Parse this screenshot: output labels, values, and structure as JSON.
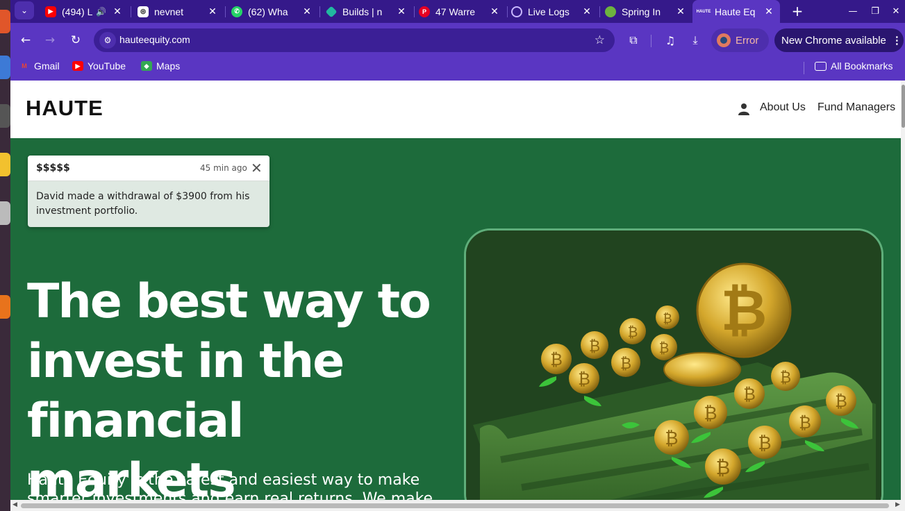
{
  "tabs": [
    {
      "title": "(494) L",
      "favicon": "youtube-icon",
      "color": "#ff0000",
      "audio": true
    },
    {
      "title": "nevnet",
      "favicon": "chatgpt-icon",
      "color": "#ffffff"
    },
    {
      "title": "(62) Wha",
      "favicon": "whatsapp-icon",
      "color": "#25d366"
    },
    {
      "title": "Builds | n",
      "favicon": "diamond-icon",
      "color": "#22b8a0"
    },
    {
      "title": "47 Warre",
      "favicon": "pinterest-icon",
      "color": "#e60023"
    },
    {
      "title": "Live Logs",
      "favicon": "logs-icon",
      "color": "#c9b8ff"
    },
    {
      "title": "Spring In",
      "favicon": "spring-icon",
      "color": "#6db33f"
    },
    {
      "title": "Haute Eq",
      "favicon": "haute-favicon",
      "color": "#ffffff",
      "active": true
    }
  ],
  "toolbar": {
    "url": "hauteequity.com",
    "error_label": "Error",
    "update_label": "New Chrome available"
  },
  "bookmarks": {
    "items": [
      {
        "label": "Gmail",
        "icon": "gmail-icon",
        "color": "#ea4335"
      },
      {
        "label": "YouTube",
        "icon": "youtube-icon",
        "color": "#ff0000"
      },
      {
        "label": "Maps",
        "icon": "maps-icon",
        "color": "#34a853"
      }
    ],
    "all_label": "All Bookmarks"
  },
  "site": {
    "logo": "HAUTE",
    "nav": [
      "About Us",
      "Fund Managers"
    ]
  },
  "toast": {
    "title": "$$$$$",
    "time": "45 min ago",
    "message": "David made a withdrawal of $3900 from his investment portfolio."
  },
  "hero": {
    "title": "The best way to invest in the financial markets",
    "subtitle": "Haute Equity is the safest and easiest way to make smarter investments and earn real returns. We make"
  },
  "colors": {
    "chrome": "#5a36c2",
    "hero_bg": "#1d6b3b",
    "accent_gold": "#d4a72c"
  }
}
